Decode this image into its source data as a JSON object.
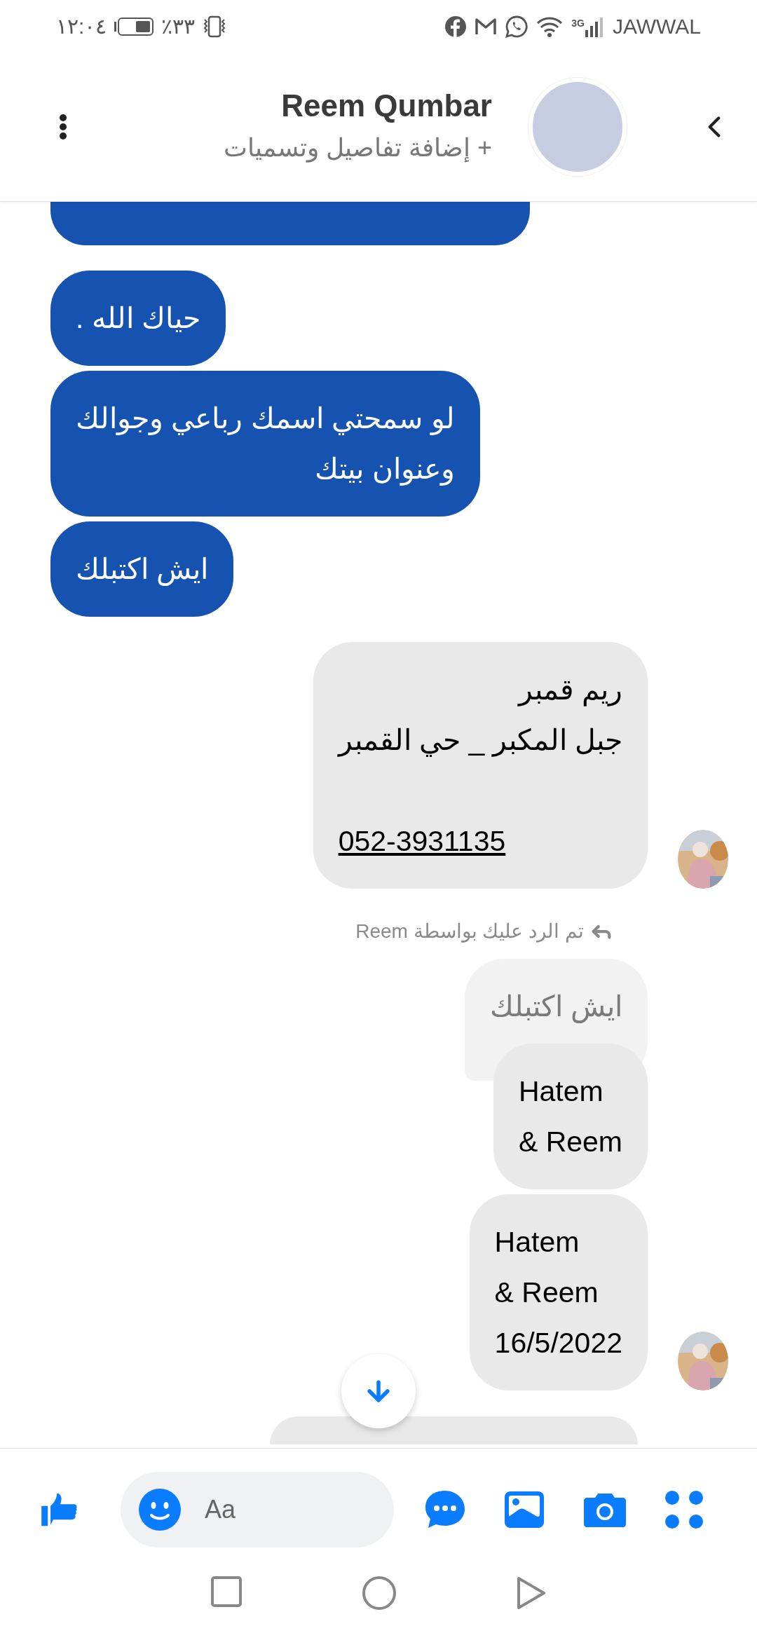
{
  "status_bar": {
    "time": "١٢:٠٤",
    "battery": "٪٣٣",
    "network": "3G",
    "carrier": "JAWWAL"
  },
  "header": {
    "name": "Reem Qumbar",
    "subtitle": "+ إضافة تفاصيل وتسميات"
  },
  "messages": [
    {
      "kind": "sent_cut"
    },
    {
      "kind": "sent",
      "lines": [
        "حياك الله ."
      ]
    },
    {
      "kind": "sent",
      "lines": [
        "لو سمحتي اسمك رباعي وجوالك",
        "وعنوان بيتك"
      ]
    },
    {
      "kind": "sent",
      "lines": [
        "ايش اكتبلك"
      ]
    },
    {
      "kind": "received",
      "lines": [
        "ريم قمبر",
        "جبل المكبر _ حي القمبر"
      ],
      "phone": "052-3931135",
      "avatar": true
    },
    {
      "kind": "reply_note",
      "text": "تم الرد عليك بواسطة Reem"
    },
    {
      "kind": "quoted",
      "lines": [
        "ايش اكتبلك"
      ]
    },
    {
      "kind": "received",
      "lines": [
        "Hatem",
        "& Reem"
      ],
      "avatar": false
    },
    {
      "kind": "received",
      "lines": [
        "Hatem",
        "& Reem",
        "16/5/2022"
      ],
      "avatar": true
    },
    {
      "kind": "received_cut"
    }
  ],
  "composer": {
    "placeholder": "Aa"
  }
}
